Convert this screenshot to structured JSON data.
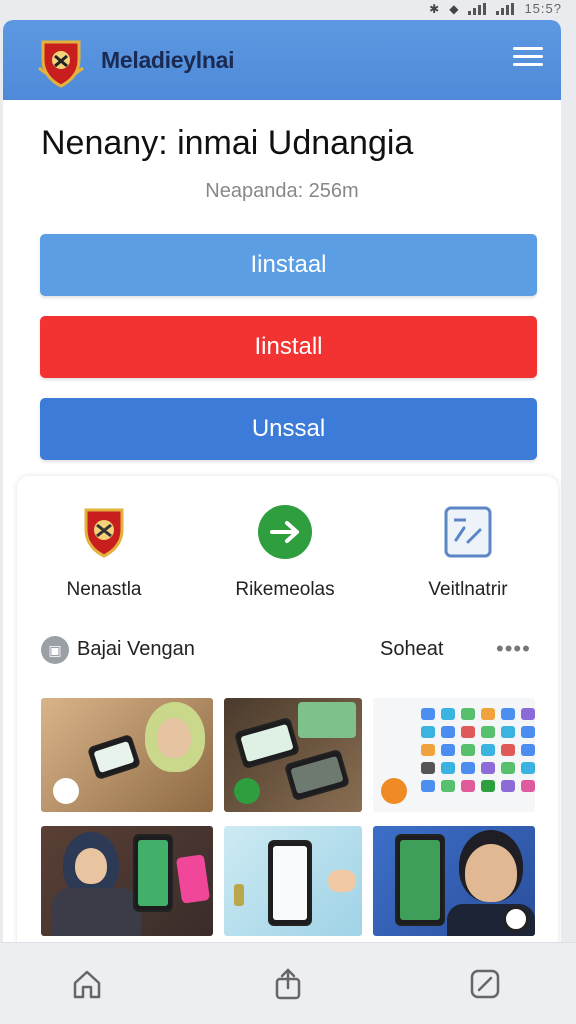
{
  "status_bar": {
    "time": "15:5?"
  },
  "header": {
    "app_name": "Meladieylnai",
    "logo_icon": "shield-crest-icon",
    "menu_icon": "hamburger-menu-icon"
  },
  "main": {
    "title": "Nenany: inmai Udnangia",
    "subtitle": "Neapanda: 256m",
    "buttons": [
      {
        "label": "Iinstaal",
        "color": "#5b9ee4"
      },
      {
        "label": "Iinstall",
        "color": "#f33232"
      },
      {
        "label": "Unssal",
        "color": "#3d7bd9"
      }
    ]
  },
  "features": [
    {
      "label": "Nenastla",
      "icon": "shield-crest-icon"
    },
    {
      "label": "Rikemeolas",
      "icon": "arrow-right-circle-icon"
    },
    {
      "label": "Veitlnatrir",
      "icon": "document-edit-icon"
    }
  ],
  "section": {
    "icon": "gallery-icon",
    "label": "Bajai Vengan",
    "right_label": "Soheat",
    "more": "••••"
  },
  "colors": {
    "header": "#5d98e2",
    "accent_green": "#2e9e3e",
    "accent_red": "#f33232"
  },
  "bottom_nav": [
    {
      "icon": "home-icon"
    },
    {
      "icon": "share-icon"
    },
    {
      "icon": "edit-icon"
    }
  ]
}
